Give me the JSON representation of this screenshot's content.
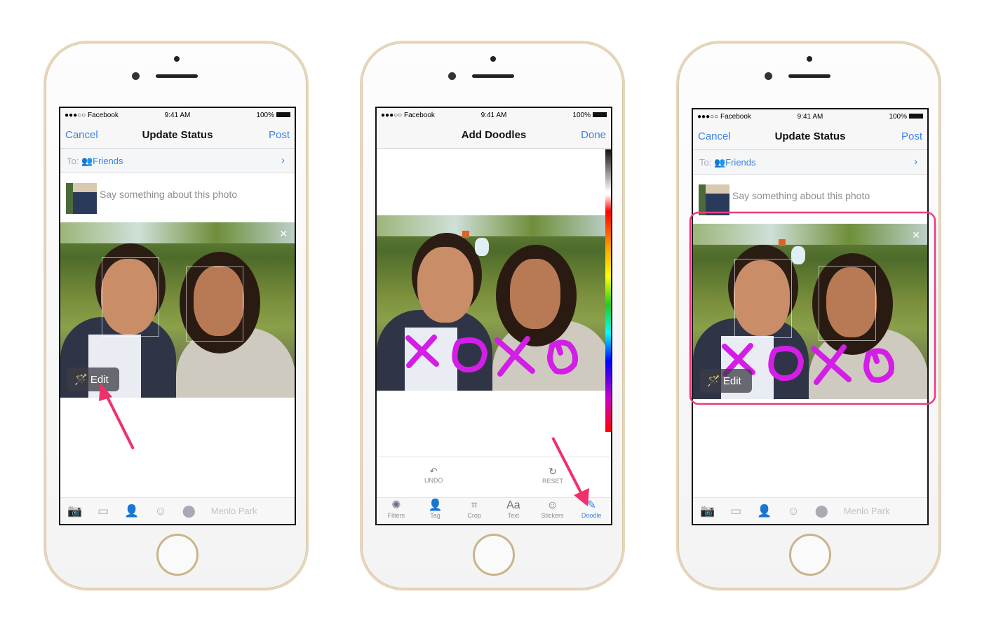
{
  "status_bar": {
    "carrier": "●●●○○ Facebook",
    "time": "9:41 AM",
    "battery": "100%"
  },
  "phones": [
    {
      "nav": {
        "left": "Cancel",
        "title": "Update Status",
        "right": "Post"
      },
      "to": {
        "label": "To:",
        "audience": "Friends"
      },
      "composer": {
        "placeholder": "Say something about this photo"
      },
      "photo": {
        "edit_label": "Edit"
      },
      "bottom_bar": {
        "location": "Menlo Park"
      }
    },
    {
      "nav": {
        "title": "Add Doodles",
        "right": "Done"
      },
      "tools": {
        "undo": "UNDO",
        "reset": "RESET",
        "tabs": [
          {
            "label": "Filters",
            "icon": "aperture-icon"
          },
          {
            "label": "Tag",
            "icon": "tag-person-icon"
          },
          {
            "label": "Crop",
            "icon": "crop-icon"
          },
          {
            "label": "Text",
            "glyph": "Aa",
            "icon": "text-icon"
          },
          {
            "label": "Stickers",
            "icon": "smiley-icon"
          },
          {
            "label": "Doodle",
            "icon": "pencil-icon",
            "active": true
          }
        ]
      }
    },
    {
      "nav": {
        "left": "Cancel",
        "title": "Update Status",
        "right": "Post"
      },
      "to": {
        "label": "To:",
        "audience": "Friends"
      },
      "composer": {
        "placeholder": "Say something about this photo"
      },
      "photo": {
        "edit_label": "Edit"
      },
      "bottom_bar": {
        "location": "Menlo Park"
      }
    }
  ],
  "colors": {
    "accent": "#3b82e6",
    "annotation": "#f0306a",
    "doodle": "#d21ee6"
  }
}
